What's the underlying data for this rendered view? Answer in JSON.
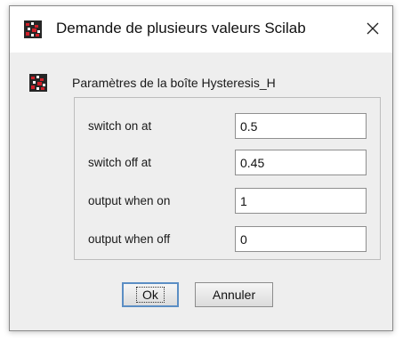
{
  "window": {
    "title": "Demande de plusieurs valeurs Scilab",
    "icon": "scilab-icon",
    "close_icon": "close-icon"
  },
  "header": {
    "text": "Paramètres de la boîte Hysteresis_H",
    "icon": "scilab-icon"
  },
  "params": [
    {
      "label": "switch on at",
      "value": "0.5"
    },
    {
      "label": "switch off at",
      "value": "0.45"
    },
    {
      "label": "output when on",
      "value": "1"
    },
    {
      "label": "output when off",
      "value": "0"
    }
  ],
  "buttons": {
    "ok_label": "Ok",
    "cancel_label": "Annuler"
  },
  "colors": {
    "dialog_background": "#eeeeee",
    "focus_border": "#5b8ec4",
    "icon_red": "#d0202a"
  }
}
